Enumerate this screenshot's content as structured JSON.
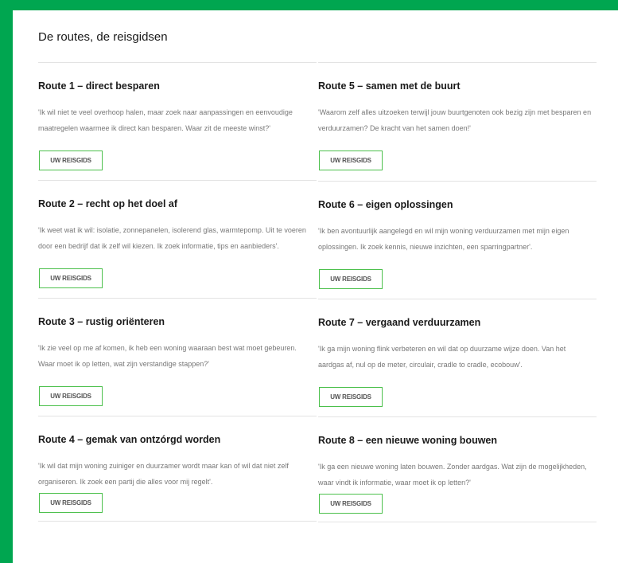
{
  "page": {
    "heading": "De routes, de reisgidsen",
    "accent_color": "#00a650",
    "button_border_color": "#4cc04c"
  },
  "routes_left": [
    {
      "title": "Route 1 – direct besparen",
      "text": "'Ik wil niet te veel overhoop halen, maar zoek naar aanpassingen en eenvoudige maatregelen waarmee ik direct kan besparen. Waar zit de meeste winst?'",
      "button": "UW REISGIDS"
    },
    {
      "title": "Route 2 – recht op het doel af",
      "text": "'Ik weet wat ik wil: isolatie, zonnepanelen, isolerend glas, warmtepomp. Uit te voeren door een bedrijf dat ik zelf wil kiezen.  Ik zoek informatie, tips en aanbieders'.",
      "button": "UW REISGIDS"
    },
    {
      "title": "Route 3 – rustig oriënteren",
      "text": "'Ik zie veel op me af komen, ik heb een woning waaraan best wat moet gebeuren. Waar moet ik op letten, wat zijn verstandige stappen?'",
      "button": "UW REISGIDS"
    },
    {
      "title": "Route 4 –  gemak van ontzórgd worden",
      "text": "'Ik wil dat mijn woning zuiniger en duurzamer wordt maar kan of wil dat niet zelf organiseren. Ik zoek een partij die alles voor mij regelt'.",
      "button": "UW REISGIDS"
    }
  ],
  "routes_right": [
    {
      "title": "Route 5 – samen met de buurt",
      "text": "'Waarom zelf alles uitzoeken terwijl jouw buurtgenoten ook bezig zijn met besparen en verduurzamen? De kracht van het samen doen!'",
      "button": "UW REISGIDS"
    },
    {
      "title": "Route 6 – eigen oplossingen",
      "text": "'Ik ben avontuurlijk aangelegd en wil mijn woning verduurzamen met mijn eigen oplossingen. Ik zoek kennis, nieuwe inzichten, een sparringpartner'.",
      "button": "UW REISGIDS"
    },
    {
      "title": "Route 7 – vergaand verduurzamen",
      "text": "'Ik ga mijn woning flink verbeteren en wil dat op duurzame wijze doen. Van het aardgas af, nul op de meter, circulair, cradle to cradle, ecobouw'.",
      "button": "UW REISGIDS"
    },
    {
      "title": "Route 8 – een nieuwe woning bouwen",
      "text": "'Ik ga een nieuwe woning laten bouwen. Zonder aardgas. Wat zijn de mogelijkheden, waar vindt ik informatie, waar moet ik op letten?'",
      "button": "UW REISGIDS"
    }
  ]
}
